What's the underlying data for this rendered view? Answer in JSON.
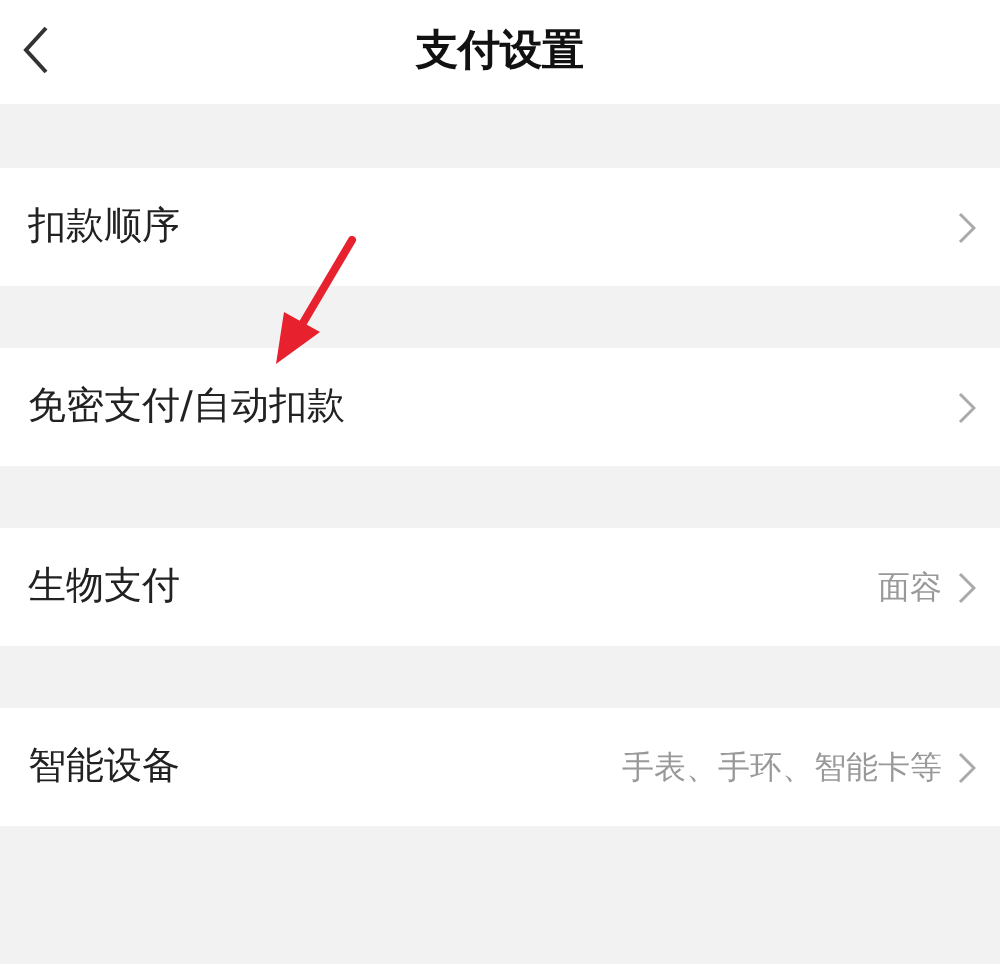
{
  "header": {
    "title": "支付设置"
  },
  "rows": [
    {
      "label": "扣款顺序"
    },
    {
      "label": "免密支付/自动扣款"
    },
    {
      "label": "生物支付",
      "value": "面容"
    },
    {
      "label": "智能设备",
      "value": "手表、手环、智能卡等"
    }
  ]
}
